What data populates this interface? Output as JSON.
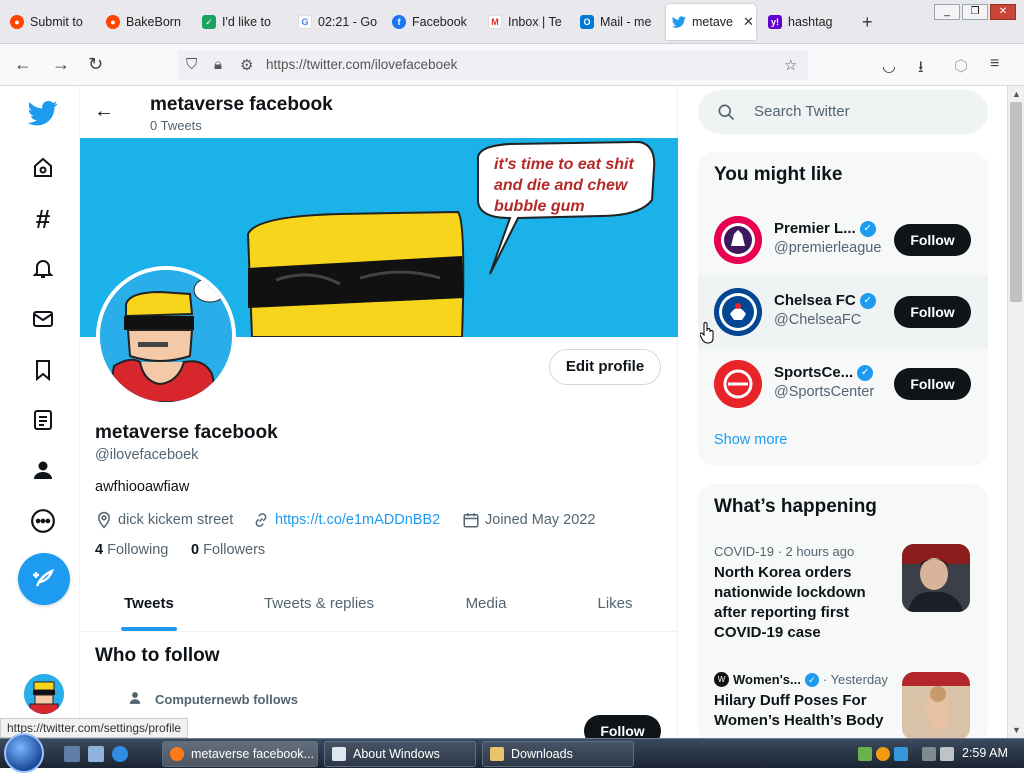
{
  "browser": {
    "tabs": [
      {
        "title": "Submit to",
        "color": "#ff4500"
      },
      {
        "title": "BakeBorn",
        "color": "#ff4500"
      },
      {
        "title": "I'd like to",
        "color": "#1aa260"
      },
      {
        "title": "02:21 - Go",
        "color": "#4285f4"
      },
      {
        "title": "Facebook",
        "color": "#1877f2"
      },
      {
        "title": "Inbox | Te",
        "color": "#d93025"
      },
      {
        "title": "Mail - me",
        "color": "#0078d4"
      },
      {
        "title": "metave",
        "color": "#1d9bf0"
      },
      {
        "title": "hashtag",
        "color": "#6001d2"
      }
    ],
    "url": "https://twitter.com/ilovefaceboek",
    "status_url": "https://twitter.com/settings/profile"
  },
  "header": {
    "name": "metaverse facebook",
    "tweet_count": "0 Tweets"
  },
  "banner": {
    "speech_text": [
      "it's time to eat shit",
      "and die and chew",
      "bubble gum"
    ]
  },
  "profile": {
    "edit_label": "Edit profile",
    "name": "metaverse facebook",
    "handle": "@ilovefaceboek",
    "bio": "awfhiooawfiaw",
    "location": "dick kickem street",
    "link": "https://t.co/e1mADDnBB2",
    "joined": "Joined May 2022",
    "following_count": "4",
    "following_label": "Following",
    "followers_count": "0",
    "followers_label": "Followers"
  },
  "tabs": [
    "Tweets",
    "Tweets & replies",
    "Media",
    "Likes"
  ],
  "who_to_follow": {
    "title": "Who to follow",
    "sub": "Computernewb follows",
    "follow_label": "Follow"
  },
  "search": {
    "placeholder": "Search Twitter"
  },
  "you_might_like": {
    "title": "You might like",
    "accounts": [
      {
        "name": "Premier L...",
        "handle": "@premierleague",
        "follow": "Follow",
        "color": "#e90052"
      },
      {
        "name": "Chelsea FC",
        "handle": "@ChelseaFC",
        "follow": "Follow",
        "color": "#034694"
      },
      {
        "name": "SportsCe...",
        "handle": "@SportsCenter",
        "follow": "Follow",
        "color": "#e8232a"
      }
    ],
    "show_more": "Show more"
  },
  "happening": {
    "title": "What’s happening",
    "trends": [
      {
        "meta": "COVID-19 · 2 hours ago",
        "title": "North Korea orders nationwide lockdown after reporting first COVID-19 case"
      },
      {
        "source": "Women's...",
        "when": "· Yesterday",
        "title": "Hilary Duff Poses For Women’s Health’s Body"
      }
    ]
  },
  "taskbar": {
    "buttons": [
      "metaverse facebook...",
      "About Windows",
      "Downloads"
    ],
    "clock": "2:59 AM"
  },
  "colors": {
    "accent": "#1d9bf0",
    "text": "#0f1419",
    "muted": "#536471"
  }
}
